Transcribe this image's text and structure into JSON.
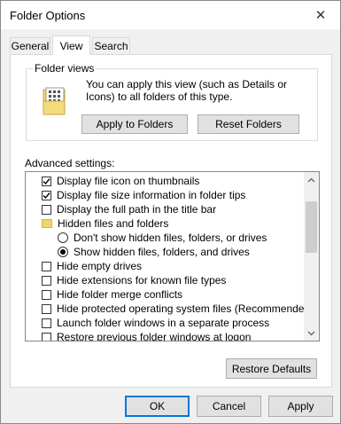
{
  "window": {
    "title": "Folder Options",
    "close_glyph": "✕"
  },
  "tabs": [
    {
      "label": "General",
      "active": false
    },
    {
      "label": "View",
      "active": true
    },
    {
      "label": "Search",
      "active": false
    }
  ],
  "folder_views": {
    "legend": "Folder views",
    "description": "You can apply this view (such as Details or Icons) to all folders of this type.",
    "icon": "folder-views-icon",
    "apply_button": "Apply to Folders",
    "reset_button": "Reset Folders"
  },
  "advanced": {
    "label": "Advanced settings:",
    "items": [
      {
        "type": "checkbox",
        "checked": true,
        "label": "Display file icon on thumbnails"
      },
      {
        "type": "checkbox",
        "checked": true,
        "label": "Display file size information in folder tips"
      },
      {
        "type": "checkbox",
        "checked": false,
        "label": "Display the full path in the title bar"
      },
      {
        "type": "folder",
        "label": "Hidden files and folders"
      },
      {
        "type": "radio",
        "checked": false,
        "label": "Don't show hidden files, folders, or drives"
      },
      {
        "type": "radio",
        "checked": true,
        "label": "Show hidden files, folders, and drives"
      },
      {
        "type": "checkbox",
        "checked": false,
        "label": "Hide empty drives"
      },
      {
        "type": "checkbox",
        "checked": false,
        "label": "Hide extensions for known file types"
      },
      {
        "type": "checkbox",
        "checked": false,
        "label": "Hide folder merge conflicts"
      },
      {
        "type": "checkbox",
        "checked": false,
        "label": "Hide protected operating system files (Recommended)"
      },
      {
        "type": "checkbox",
        "checked": false,
        "label": "Launch folder windows in a separate process"
      },
      {
        "type": "checkbox",
        "checked": false,
        "label": "Restore previous folder windows at logon"
      }
    ],
    "restore_defaults": "Restore Defaults"
  },
  "footer": {
    "ok": "OK",
    "cancel": "Cancel",
    "apply": "Apply"
  },
  "colors": {
    "accent": "#0078d7",
    "check": "#000000",
    "folder": "#f2d46b"
  }
}
